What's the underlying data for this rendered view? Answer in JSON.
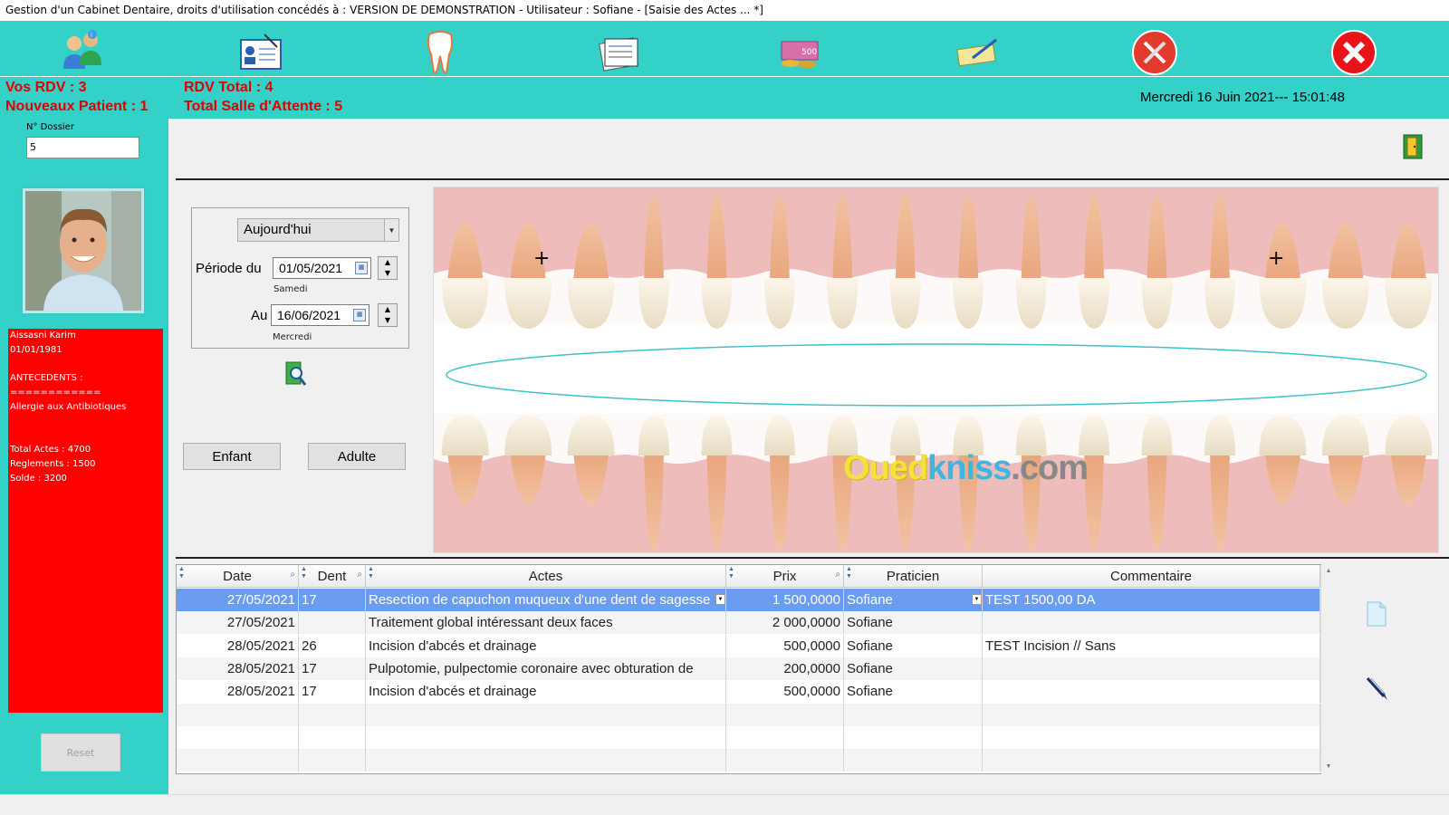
{
  "window": {
    "title": "Gestion d'un Cabinet Dentaire, droits d'utilisation concédés à : VERSION DE DEMONSTRATION - Utilisateur : Sofiane - [Saisie des Actes ... *]"
  },
  "toolbar": {
    "buttons": [
      {
        "name": "patients-icon"
      },
      {
        "name": "dossier-icon"
      },
      {
        "name": "tooth-icon"
      },
      {
        "name": "documents-icon"
      },
      {
        "name": "money-icon"
      },
      {
        "name": "payments-icon"
      },
      {
        "name": "tools-icon"
      },
      {
        "name": "close-icon"
      }
    ]
  },
  "stats": {
    "vos_rdv": "Vos RDV : 3",
    "nouveaux_patient": "Nouveaux Patient : 1",
    "rdv_total": "RDV Total : 4",
    "salle_attente": "Total Salle d'Attente : 5",
    "datetime": "Mercredi 16 Juin 2021--- 15:01:48"
  },
  "sidebar": {
    "dossier_label": "N° Dossier",
    "dossier_value": "5",
    "patient_info": {
      "name": "Aissasni Karim",
      "birth": "01/01/1981",
      "antecedents_label": "ANTECEDENTS :",
      "separator": "============",
      "antecedent": "Allergie aux Antibiotiques",
      "total_actes": "Total Actes : 4700",
      "reglements": "Reglements   : 1500",
      "solde": "Solde : 3200"
    },
    "reset_label": "Reset"
  },
  "filter": {
    "period_selected": "Aujourd'hui",
    "periode_du_label": "Période du",
    "date_from": "01/05/2021",
    "date_from_day": "Samedi",
    "au_label": "Au",
    "date_to": "16/06/2021",
    "date_to_day": "Mercredi"
  },
  "buttons": {
    "enfant": "Enfant",
    "adulte": "Adulte"
  },
  "watermark": {
    "part1": "Oued",
    "part2": "kniss",
    "part3": ".com"
  },
  "table": {
    "headers": [
      "Date",
      "Dent",
      "Actes",
      "Prix",
      "Praticien",
      "Commentaire"
    ],
    "rows": [
      {
        "date": "27/05/2021",
        "dent": "17",
        "acte": "Resection de capuchon muqueux d'une dent de sagesse",
        "prix": "1 500,0000",
        "praticien": "Sofiane",
        "commentaire": "TEST 1500,00 DA"
      },
      {
        "date": "27/05/2021",
        "dent": "",
        "acte": "Traitement global intéressant deux faces",
        "prix": "2 000,0000",
        "praticien": "Sofiane",
        "commentaire": ""
      },
      {
        "date": "28/05/2021",
        "dent": "26",
        "acte": "Incision d'abcés et drainage",
        "prix": "500,0000",
        "praticien": "Sofiane",
        "commentaire": "TEST Incision // Sans"
      },
      {
        "date": "28/05/2021",
        "dent": "17",
        "acte": "Pulpotomie, pulpectomie coronaire avec obturation de",
        "prix": "200,0000",
        "praticien": "Sofiane",
        "commentaire": ""
      },
      {
        "date": "28/05/2021",
        "dent": "17",
        "acte": "Incision d'abcés et drainage",
        "prix": "500,0000",
        "praticien": "Sofiane",
        "commentaire": ""
      }
    ],
    "selected_row": 0
  },
  "colors": {
    "toolbar_bg": "#33d1c8",
    "stat_red": "#e00000",
    "patient_box": "#ff0000",
    "selected_row": "#6a9cf0"
  }
}
